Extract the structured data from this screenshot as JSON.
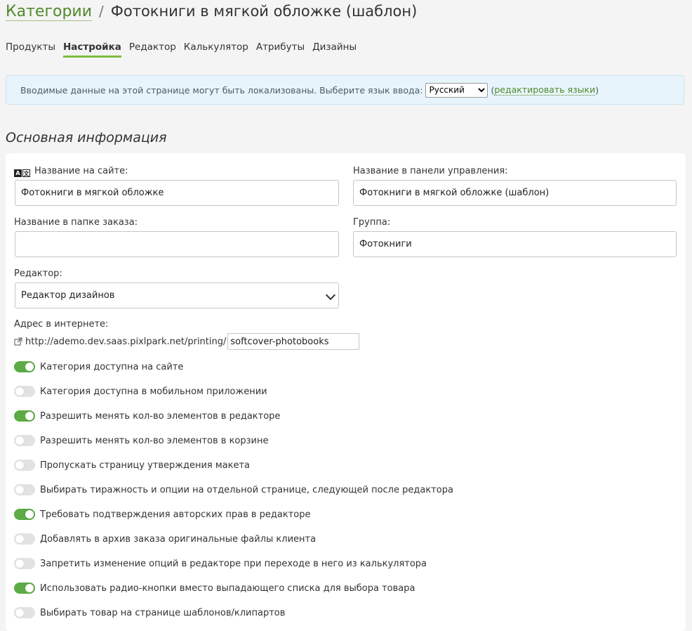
{
  "breadcrumb": {
    "parent": "Категории",
    "separator": "/",
    "title": "Фотокниги в мягкой обложке (шаблон)"
  },
  "tabs": [
    {
      "label": "Продукты",
      "active": false
    },
    {
      "label": "Настройка",
      "active": true
    },
    {
      "label": "Редактор",
      "active": false
    },
    {
      "label": "Калькулятор",
      "active": false
    },
    {
      "label": "Атрибуты",
      "active": false
    },
    {
      "label": "Дизайны",
      "active": false
    }
  ],
  "notice": {
    "text": "Вводимые данные на этой странице могут быть локализованы. Выберите язык ввода:",
    "language": "Русский",
    "open_paren": "(",
    "edit_link": "редактировать языки",
    "close_paren": ")"
  },
  "section_title": "Основная информация",
  "form": {
    "site_name_label": "Название на сайте:",
    "site_name_value": "Фотокниги в мягкой обложке",
    "admin_name_label": "Название в панели управления:",
    "admin_name_value": "Фотокниги в мягкой обложке (шаблон)",
    "order_folder_label": "Название в папке заказа:",
    "order_folder_value": "",
    "group_label": "Группа:",
    "group_value": "Фотокниги",
    "editor_label": "Редактор:",
    "editor_value": "Редактор дизайнов",
    "url_label": "Адрес в интернете:",
    "url_prefix": "http://ademo.dev.saas.pixlpark.net/printing/",
    "url_slug": "softcover-photobooks"
  },
  "toggles": [
    {
      "label": "Категория доступна на сайте",
      "on": true
    },
    {
      "label": "Категория доступна в мобильном приложении",
      "on": false
    },
    {
      "label": "Разрешить менять кол-во элементов в редакторе",
      "on": true
    },
    {
      "label": "Разрешить менять кол-во элементов в корзине",
      "on": false
    },
    {
      "label": "Пропускать страницу утверждения макета",
      "on": false
    },
    {
      "label": "Выбирать тиражность и опции на отдельной странице, следующей после редактора",
      "on": false
    },
    {
      "label": "Требовать подтверждения авторских прав в редакторе",
      "on": true
    },
    {
      "label": "Добавлять в архив заказа оригинальные файлы клиента",
      "on": false
    },
    {
      "label": "Запретить изменение опций в редакторе при переходе в него из калькулятора",
      "on": false
    },
    {
      "label": "Использовать радио-кнопки вместо выпадающего списка для выбора товара",
      "on": true
    },
    {
      "label": "Выбирать товар на странице шаблонов/клипартов",
      "on": false
    }
  ],
  "colors": {
    "accent": "#7dbb3c",
    "link": "#4f8a2b",
    "toggle_on": "#5cab45",
    "notice_bg": "#e8f4fb"
  }
}
